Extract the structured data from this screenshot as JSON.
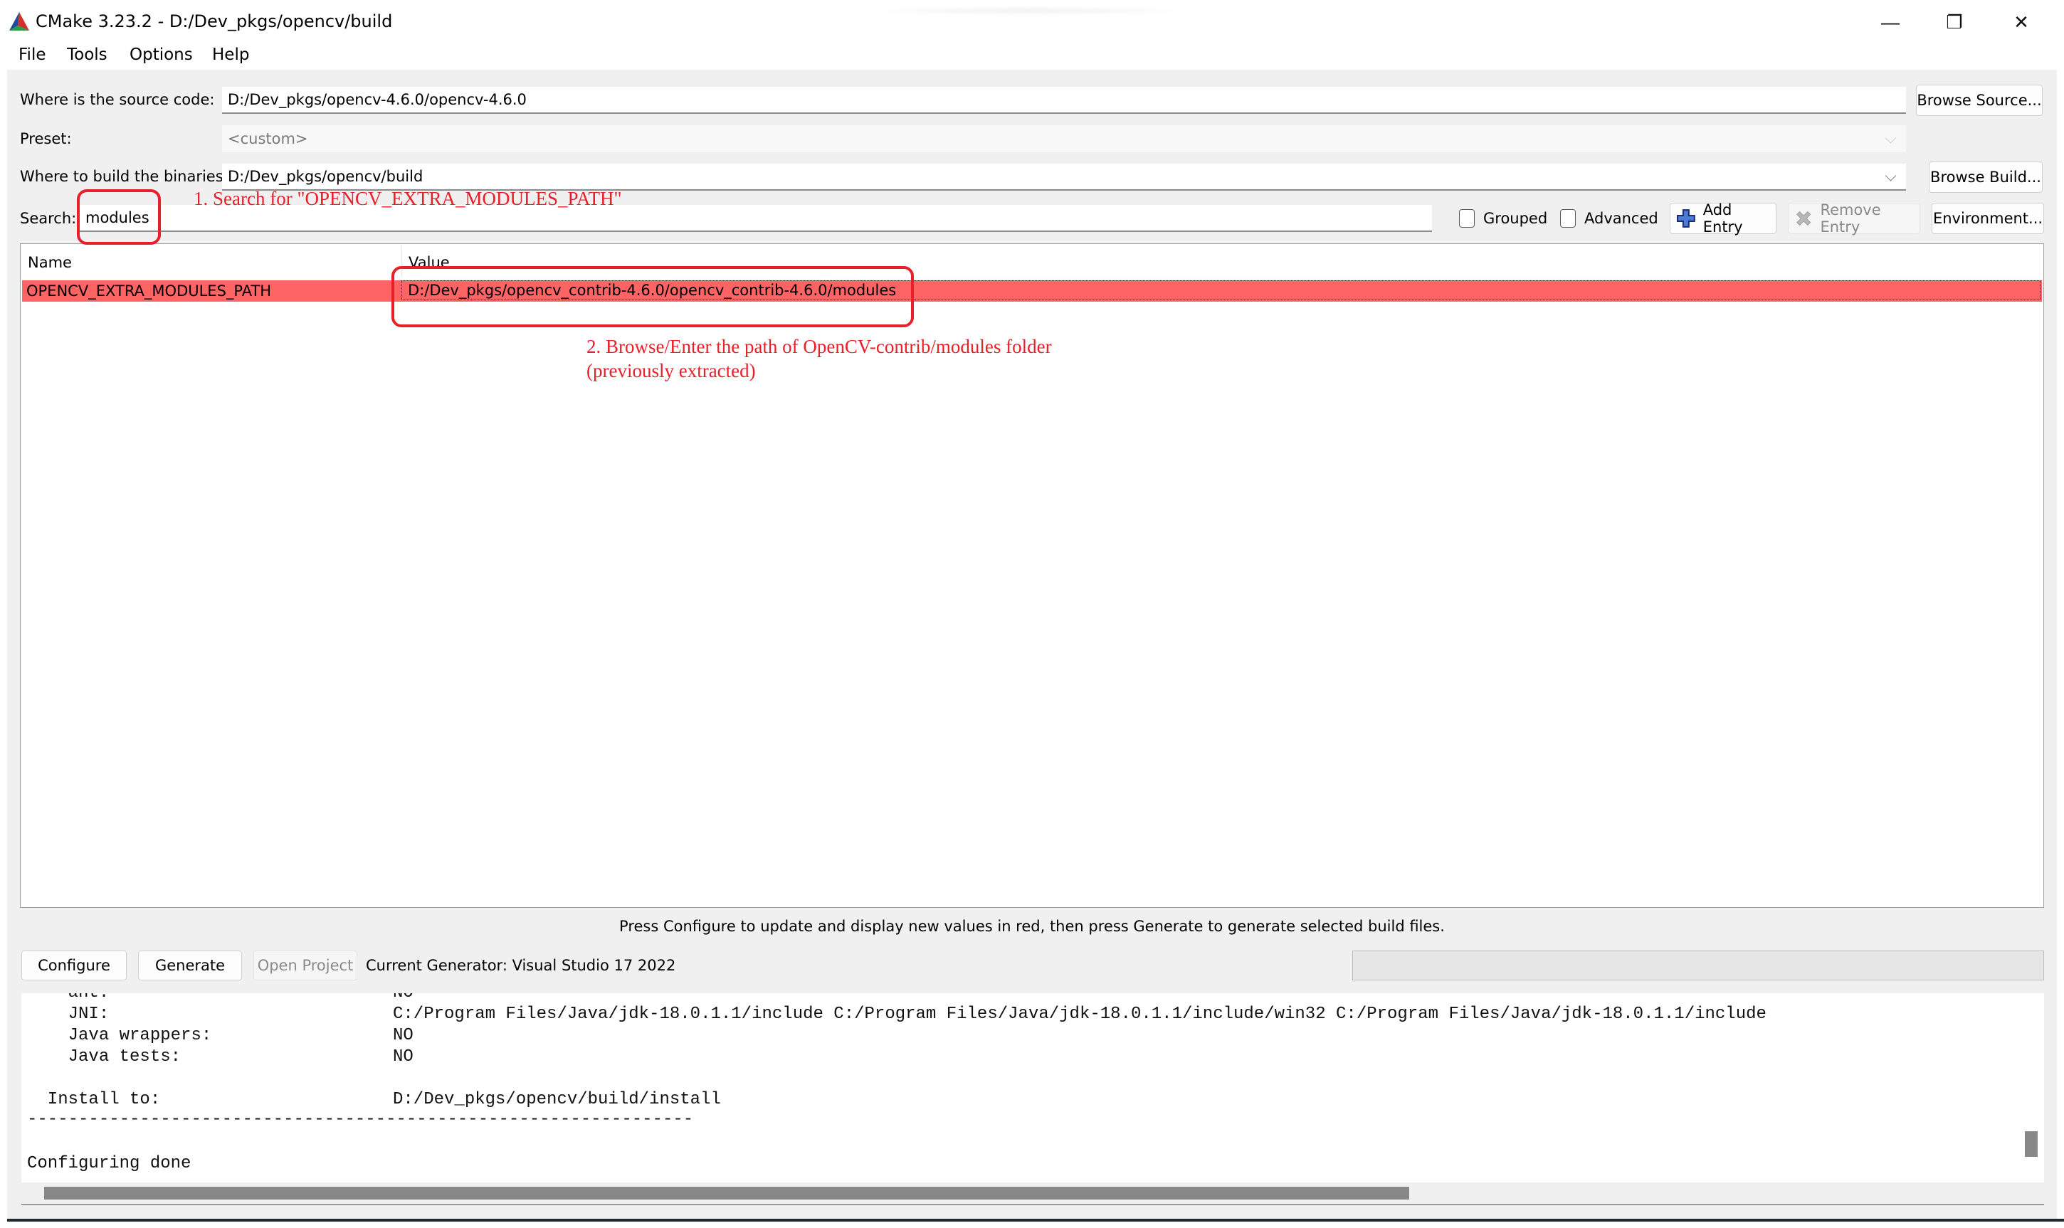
{
  "window": {
    "title": "CMake 3.23.2 - D:/Dev_pkgs/opencv/build",
    "controls": {
      "minimize": "—",
      "restore": "❐",
      "close": "✕"
    }
  },
  "menu": {
    "items": [
      "File",
      "Tools",
      "Options",
      "Help"
    ]
  },
  "paths": {
    "source_label": "Where is the source code:",
    "source_value": "D:/Dev_pkgs/opencv-4.6.0/opencv-4.6.0",
    "browse_source": "Browse Source...",
    "preset_label": "Preset:",
    "preset_value": "<custom>",
    "build_label": "Where to build the binaries:",
    "build_value": "D:/Dev_pkgs/opencv/build",
    "browse_build": "Browse Build..."
  },
  "search": {
    "label": "Search:",
    "value": "modules",
    "grouped_label": "Grouped",
    "grouped_checked": false,
    "advanced_label": "Advanced",
    "advanced_checked": false,
    "add_entry": "Add Entry",
    "remove_entry": "Remove Entry",
    "environment": "Environment..."
  },
  "table": {
    "columns": [
      "Name",
      "Value"
    ],
    "rows": [
      {
        "name": "OPENCV_EXTRA_MODULES_PATH",
        "value": "D:/Dev_pkgs/opencv_contrib-4.6.0/opencv_contrib-4.6.0/modules",
        "highlight_color": "#ff6464"
      }
    ]
  },
  "status_text": "Press Configure to update and display new values in red, then press Generate to generate selected build files.",
  "actions": {
    "configure": "Configure",
    "generate": "Generate",
    "open_project": "Open Project",
    "generator": "Current Generator: Visual Studio 17 2022",
    "progress": 0
  },
  "log": {
    "lines": [
      {
        "key": "    ant:",
        "value": "NO"
      },
      {
        "key": "    JNI:",
        "value": "C:/Program Files/Java/jdk-18.0.1.1/include C:/Program Files/Java/jdk-18.0.1.1/include/win32 C:/Program Files/Java/jdk-18.0.1.1/include"
      },
      {
        "key": "    Java wrappers:",
        "value": "NO"
      },
      {
        "key": "    Java tests:",
        "value": "NO"
      },
      {
        "key": "",
        "value": ""
      },
      {
        "key": "  Install to:",
        "value": "D:/Dev_pkgs/opencv/build/install"
      }
    ],
    "separator": "-----------------------------------------------------------------",
    "final": "Configuring done"
  },
  "annotations": {
    "step1": "1. Search for \"OPENCV_EXTRA_MODULES_PATH\"",
    "step2_line1": "2. Browse/Enter the path of OpenCV-contrib/modules folder",
    "step2_line2": "(previously extracted)",
    "color": "#e8202a"
  }
}
